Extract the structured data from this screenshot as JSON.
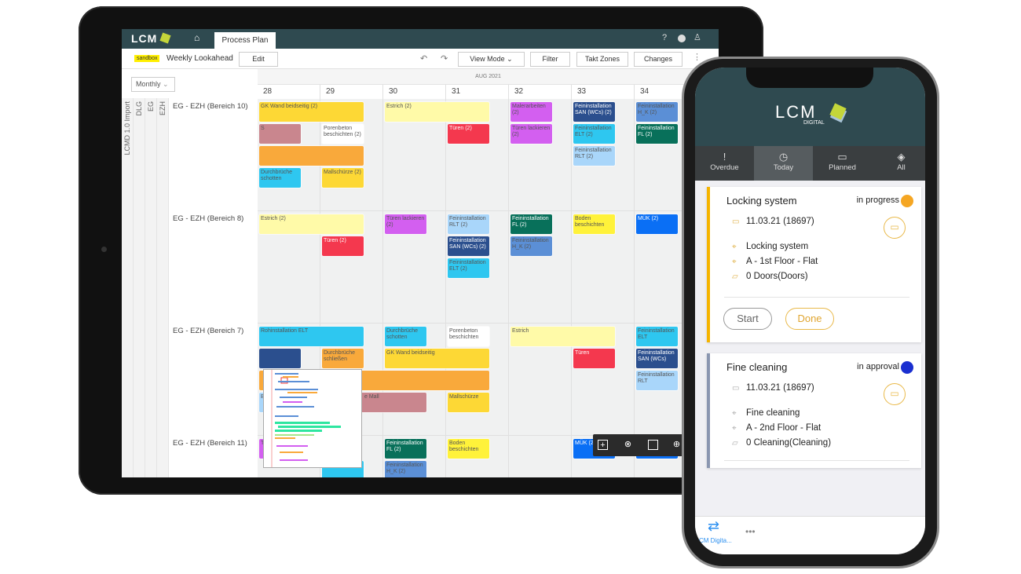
{
  "tablet": {
    "app_logo": "LCM",
    "header": {
      "tab": "Process Plan",
      "icons": [
        "home-icon",
        "help-icon",
        "info-icon",
        "user-icon"
      ],
      "help": "?"
    },
    "toolbar": {
      "badge": "sandbox",
      "title": "Weekly Lookahead",
      "edit": "Edit",
      "view_mode": "View Mode",
      "filter": "Filter",
      "takt_zones": "Takt Zones",
      "changes": "Changes"
    },
    "period_select": "Monthly",
    "month": "AUG 2021",
    "weeks": [
      "28",
      "29",
      "30",
      "31",
      "32",
      "33",
      "34"
    ],
    "hierarchy": [
      "LCMD 1.0 Import",
      "DLG",
      "EG",
      "EZH"
    ],
    "areas": [
      {
        "label": "EG - EZH (Bereich 10)",
        "tasks": [
          {
            "text": "GK Wand beidseitig (2)",
            "week": 28,
            "span": 2,
            "lane": 0,
            "color": "#fdd835"
          },
          {
            "text": "Estrich (2)",
            "week": 30,
            "span": 2,
            "lane": 0,
            "color": "#fffaa8"
          },
          {
            "text": "Malerarbeiten (2)",
            "week": 32,
            "span": 1,
            "lane": 0,
            "color": "#d35ff0"
          },
          {
            "text": "Feininstallation SAN (WCs) (2)",
            "week": 33,
            "span": 1,
            "lane": 0,
            "color": "#2b4f8e",
            "light": true
          },
          {
            "text": "Feininstallation H_K (2)",
            "week": 34,
            "span": 1,
            "lane": 0,
            "color": "#5b8fd6"
          },
          {
            "text": "S",
            "week": 28,
            "span": 1,
            "lane": 1,
            "color": "#c9868e"
          },
          {
            "text": "Porenbeton beschichten (2)",
            "week": 29,
            "span": 1,
            "lane": 1,
            "color": "#ffffff"
          },
          {
            "text": "Türen (2)",
            "week": 31,
            "span": 1,
            "lane": 1,
            "color": "#f4384e",
            "light": true
          },
          {
            "text": "Türen lackieren (2)",
            "week": 32,
            "span": 1,
            "lane": 1,
            "color": "#d35ff0"
          },
          {
            "text": "Feininstallation ELT (2)",
            "week": 33,
            "span": 1,
            "lane": 1,
            "color": "#2ec7f0"
          },
          {
            "text": "Feininstallation FL (2)",
            "week": 34,
            "span": 1,
            "lane": 1,
            "color": "#08705a",
            "light": true
          },
          {
            "text": "",
            "week": 28,
            "span": 2,
            "lane": 2,
            "color": "#f9a93b"
          },
          {
            "text": "Feininstallation RLT (2)",
            "week": 33,
            "span": 1,
            "lane": 2,
            "color": "#a9d6fa"
          },
          {
            "text": "Durchbrüche schotten",
            "week": 28,
            "span": 1,
            "lane": 3,
            "color": "#2ec7f0"
          },
          {
            "text": "Mallschürze (2)",
            "week": 29,
            "span": 1,
            "lane": 3,
            "color": "#fdd835"
          }
        ]
      },
      {
        "label": "EG - EZH (Bereich 8)",
        "tasks": [
          {
            "text": "Estrich (2)",
            "week": 28,
            "span": 2,
            "lane": 0,
            "color": "#fffaa8"
          },
          {
            "text": "Türen lackieren (2)",
            "week": 30,
            "span": 1,
            "lane": 0,
            "color": "#d35ff0"
          },
          {
            "text": "Feininstallation RLT (2)",
            "week": 31,
            "span": 1,
            "lane": 0,
            "color": "#a9d6fa"
          },
          {
            "text": "Feininstallation FL (2)",
            "week": 32,
            "span": 1,
            "lane": 0,
            "color": "#08705a",
            "light": true
          },
          {
            "text": "Boden beschichten",
            "week": 33,
            "span": 1,
            "lane": 0,
            "color": "#fff23a"
          },
          {
            "text": "MÜK (2)",
            "week": 34,
            "span": 1,
            "lane": 0,
            "color": "#0a6ff5",
            "light": true
          },
          {
            "text": "Türen (2)",
            "week": 29,
            "span": 1,
            "lane": 1,
            "color": "#f4384e",
            "light": true
          },
          {
            "text": "Feininstallation SAN (WCs) (2)",
            "week": 31,
            "span": 1,
            "lane": 1,
            "color": "#2b4f8e",
            "light": true
          },
          {
            "text": "Feininstallation H_K (2)",
            "week": 32,
            "span": 1,
            "lane": 1,
            "color": "#5b8fd6"
          },
          {
            "text": "Feininstallation ELT (2)",
            "week": 31,
            "span": 1,
            "lane": 2,
            "color": "#2ec7f0"
          }
        ]
      },
      {
        "label": "EG - EZH (Bereich 7)",
        "tasks": [
          {
            "text": "Rohinstallation ELT",
            "week": 28,
            "span": 2,
            "lane": 0,
            "color": "#2ec7f0"
          },
          {
            "text": "Durchbrüche schotten",
            "week": 30,
            "span": 1,
            "lane": 0,
            "color": "#2ec7f0"
          },
          {
            "text": "Porenbeton beschichten",
            "week": 31,
            "span": 1,
            "lane": 0,
            "color": "#ffffff"
          },
          {
            "text": "Estrich",
            "week": 32,
            "span": 2,
            "lane": 0,
            "color": "#fffaa8"
          },
          {
            "text": "Feininstallation ELT",
            "week": 34,
            "span": 1,
            "lane": 0,
            "color": "#2ec7f0"
          },
          {
            "text": "",
            "week": 28,
            "span": 1,
            "lane": 1,
            "color": "#2b4f8e"
          },
          {
            "text": "Durchbrüche schließen",
            "week": 29,
            "span": 1,
            "lane": 1,
            "color": "#f9a93b"
          },
          {
            "text": "GK Wand beidseitig",
            "week": 30,
            "span": 2,
            "lane": 1,
            "color": "#fdd835"
          },
          {
            "text": "Türen",
            "week": 33,
            "span": 1,
            "lane": 1,
            "color": "#f4384e",
            "light": true
          },
          {
            "text": "Feininstallation SAN (WCs)",
            "week": 34,
            "span": 1,
            "lane": 1,
            "color": "#2b4f8e",
            "light": true
          },
          {
            "text": "",
            "week": 28,
            "span": 4,
            "lane": 2,
            "color": "#f9a93b"
          },
          {
            "text": "Feininstallation RLT",
            "week": 34,
            "span": 1,
            "lane": 2,
            "color": "#a9d6fa"
          },
          {
            "text": "B",
            "week": 28,
            "span": 1,
            "lane": 3,
            "color": "#a9d6fa"
          },
          {
            "text": "e Mall",
            "week": 29,
            "span": 2,
            "lane": 3,
            "color": "#c9868e",
            "indent": true
          },
          {
            "text": "Mallschürze",
            "week": 31,
            "span": 1,
            "lane": 3,
            "color": "#fdd835"
          }
        ]
      },
      {
        "label": "EG - EZH (Bereich 11)",
        "tasks": [
          {
            "text": "T",
            "week": 28,
            "span": 1,
            "lane": 0,
            "color": "#d35ff0"
          },
          {
            "text": "Feininstallation FL (2)",
            "week": 30,
            "span": 1,
            "lane": 0,
            "color": "#08705a",
            "light": true
          },
          {
            "text": "Boden beschichten",
            "week": 31,
            "span": 1,
            "lane": 0,
            "color": "#fff23a"
          },
          {
            "text": "MÜK (2)",
            "week": 33,
            "span": 1,
            "lane": 0,
            "color": "#0a6ff5",
            "light": true
          },
          {
            "text": "",
            "week": 34,
            "span": 1,
            "lane": 0,
            "color": "#0a6ff5"
          },
          {
            "text": "ELT (2)",
            "week": 29,
            "span": 1,
            "lane": 1,
            "color": "#2ec7f0"
          },
          {
            "text": "Feininstallation H_K (2)",
            "week": 30,
            "span": 1,
            "lane": 1,
            "color": "#5b8fd6"
          }
        ]
      }
    ],
    "floating_toolbar": [
      "add-icon",
      "link-icon",
      "select-box-icon",
      "zoom-icon"
    ]
  },
  "phone": {
    "logo": "LCM",
    "logo_sub": "DIGITAL",
    "tabs": [
      {
        "label": "Overdue",
        "icon": "!"
      },
      {
        "label": "Today",
        "icon": "◷",
        "active": true
      },
      {
        "label": "Planned",
        "icon": "▭"
      },
      {
        "label": "All",
        "icon": "◈"
      }
    ],
    "cards": [
      {
        "title": "Locking system",
        "status": "in progress",
        "status_color": "#f5a623",
        "accent": "#f5b400",
        "date": "11.03.21 (18697)",
        "name": "Locking system",
        "location": "A - 1st Floor - Flat",
        "quantity": "0 Doors(Doors)",
        "start": "Start",
        "done": "Done"
      },
      {
        "title": "Fine cleaning",
        "status": "in approval",
        "status_color": "#1a2fd0",
        "accent": "#8a96b0",
        "date": "11.03.21 (18697)",
        "name": "Fine cleaning",
        "location": "A - 2nd Floor - Flat",
        "quantity": "0 Cleaning(Cleaning)"
      }
    ],
    "bottom": {
      "app_label": "CM Digita...",
      "more": "•••"
    }
  },
  "colors": {
    "brand_dark": "#2f4a50",
    "brand_lime": "#c4d63a"
  }
}
